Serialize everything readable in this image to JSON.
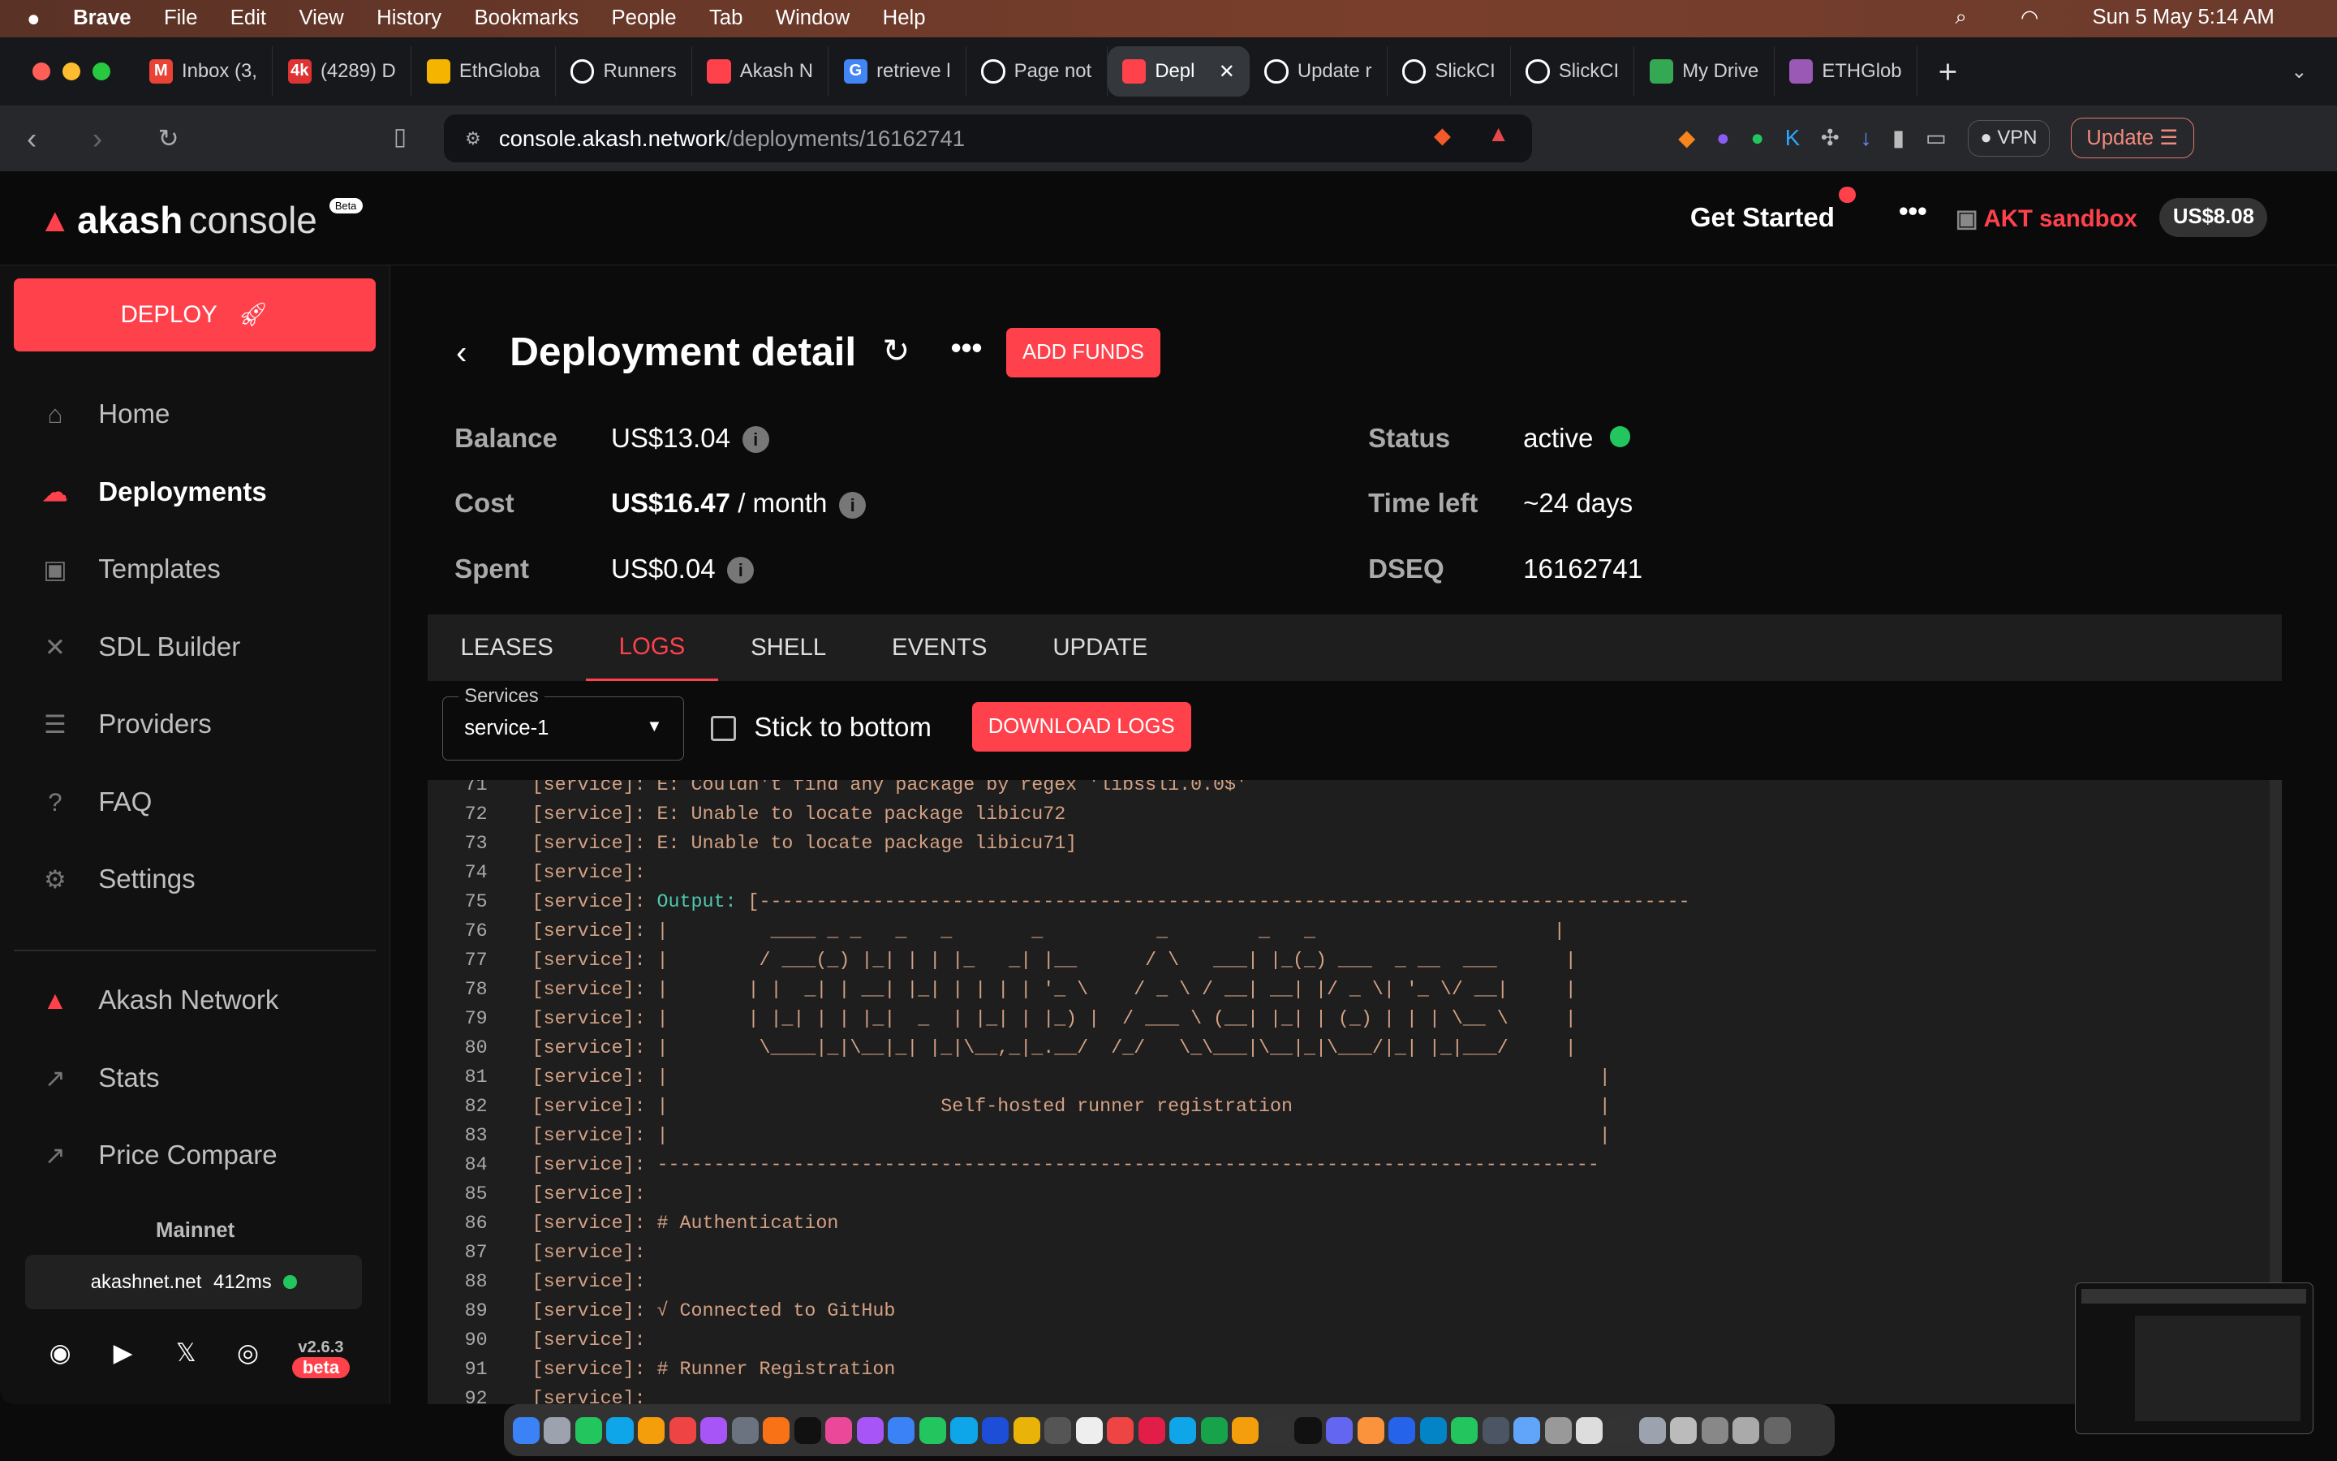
{
  "menubar": {
    "apple": "",
    "items": [
      "Brave",
      "File",
      "Edit",
      "View",
      "History",
      "Bookmarks",
      "People",
      "Tab",
      "Window",
      "Help"
    ],
    "datetime": "Sun 5 May  5:14 AM"
  },
  "browser": {
    "tabs": [
      {
        "label": "Inbox (3,",
        "icon": "gmail-icon",
        "color": "#ea4335",
        "glyph": "M"
      },
      {
        "label": "(4289) D",
        "icon": "4k-icon",
        "color": "#d33",
        "glyph": "4k"
      },
      {
        "label": "EthGloba",
        "icon": "slides-icon",
        "color": "#f4b400",
        "glyph": ""
      },
      {
        "label": "Runners",
        "icon": "github-icon",
        "color": "#fff",
        "glyph": ""
      },
      {
        "label": "Akash N",
        "icon": "akash-icon",
        "color": "#ff414c",
        "glyph": ""
      },
      {
        "label": "retrieve l",
        "icon": "google-icon",
        "color": "#4285f4",
        "glyph": "G"
      },
      {
        "label": "Page not",
        "icon": "github-icon",
        "color": "#fff",
        "glyph": ""
      },
      {
        "label": "Depl",
        "icon": "akash-icon",
        "color": "#ff414c",
        "glyph": "",
        "active": true
      },
      {
        "label": "Update r",
        "icon": "github-icon",
        "color": "#fff",
        "glyph": ""
      },
      {
        "label": "SlickCI",
        "icon": "slickci-icon",
        "color": "#fff",
        "glyph": ""
      },
      {
        "label": "SlickCI",
        "icon": "slickci-icon",
        "color": "#fff",
        "glyph": ""
      },
      {
        "label": "My Drive",
        "icon": "drive-icon",
        "color": "#34a853",
        "glyph": ""
      },
      {
        "label": "ETHGlob",
        "icon": "ethglobal-icon",
        "color": "#9b59b6",
        "glyph": ""
      }
    ],
    "url_host": "console.akash.network",
    "url_path": "/deployments/16162741",
    "vpn_label": "VPN",
    "update_label": "Update"
  },
  "header": {
    "logo_bold": "akash",
    "logo_light": "console",
    "beta": "Beta",
    "get_started": "Get Started",
    "wallet_name": "AKT sandbox",
    "wallet_balance": "US$8.08"
  },
  "sidebar": {
    "deploy_label": "DEPLOY",
    "items": [
      {
        "label": "Home",
        "icon": "home-icon",
        "glyph": "⌂"
      },
      {
        "label": "Deployments",
        "icon": "cloud-icon",
        "glyph": "☁",
        "active": true
      },
      {
        "label": "Templates",
        "icon": "image-icon",
        "glyph": "▣"
      },
      {
        "label": "SDL Builder",
        "icon": "tools-icon",
        "glyph": "✕"
      },
      {
        "label": "Providers",
        "icon": "server-icon",
        "glyph": "☰"
      },
      {
        "label": "FAQ",
        "icon": "help-icon",
        "glyph": "?"
      },
      {
        "label": "Settings",
        "icon": "gear-icon",
        "glyph": "⚙"
      }
    ],
    "links": [
      {
        "label": "Akash Network",
        "icon": "akash-icon",
        "glyph": "▲"
      },
      {
        "label": "Stats",
        "icon": "external-link-icon",
        "glyph": "↗"
      },
      {
        "label": "Price Compare",
        "icon": "external-link-icon",
        "glyph": "↗"
      }
    ],
    "network": "Mainnet",
    "node": "akashnet.net",
    "latency": "412ms",
    "version": "v2.6.3",
    "version_badge": "beta"
  },
  "deployment": {
    "title": "Deployment detail",
    "add_funds": "ADD FUNDS",
    "balance_label": "Balance",
    "balance": "US$13.04",
    "cost_label": "Cost",
    "cost": "US$16.47",
    "cost_unit": " / month",
    "spent_label": "Spent",
    "spent": "US$0.04",
    "status_label": "Status",
    "status": "active",
    "time_left_label": "Time left",
    "time_left": "~24 days",
    "dseq_label": "DSEQ",
    "dseq": "16162741",
    "tabs": [
      "LEASES",
      "LOGS",
      "SHELL",
      "EVENTS",
      "UPDATE"
    ],
    "active_tab": "LOGS",
    "services_label": "Services",
    "service_value": "service-1",
    "stick_to_bottom": "Stick to bottom",
    "stick_checked": false,
    "download_logs": "DOWNLOAD LOGS"
  },
  "logs": {
    "prefix": "[service]: ",
    "lines": [
      {
        "n": "71",
        "text": "E: Couldn't find any package by regex 'libssl1.0.0$'"
      },
      {
        "n": "72",
        "text": "E: Unable to locate package libicu72"
      },
      {
        "n": "73",
        "text": "E: Unable to locate package libicu71]"
      },
      {
        "n": "74",
        "text": ""
      },
      {
        "n": "75",
        "hl": "Output:",
        "text": " [----------------------------------------------------------------------------------"
      },
      {
        "n": "76",
        "text": "|         ____ _ _   _   _       _          _        _   _                     |"
      },
      {
        "n": "77",
        "text": "|        / ___(_) |_| | | |_   _| |__      / \\   ___| |_(_) ___  _ __  ___      |"
      },
      {
        "n": "78",
        "text": "|       | |  _| | __| |_| | | | | '_ \\    / _ \\ / __| __| |/ _ \\| '_ \\/ __|     |"
      },
      {
        "n": "79",
        "text": "|       | |_| | | |_|  _  | |_| | |_) |  / ___ \\ (__| |_| | (_) | | | \\__ \\     |"
      },
      {
        "n": "80",
        "text": "|        \\____|_|\\__|_| |_|\\__,_|_.__/  /_/   \\_\\___|\\__|_|\\___/|_| |_|___/     |"
      },
      {
        "n": "81",
        "text": "|                                                                                  |"
      },
      {
        "n": "82",
        "text": "|                        Self-hosted runner registration                           |"
      },
      {
        "n": "83",
        "text": "|                                                                                  |"
      },
      {
        "n": "84",
        "text": "-----------------------------------------------------------------------------------"
      },
      {
        "n": "85",
        "text": ""
      },
      {
        "n": "86",
        "text": "# Authentication"
      },
      {
        "n": "87",
        "text": ""
      },
      {
        "n": "88",
        "text": ""
      },
      {
        "n": "89",
        "text": "√ Connected to GitHub"
      },
      {
        "n": "90",
        "text": ""
      },
      {
        "n": "91",
        "text": "# Runner Registration"
      },
      {
        "n": "92",
        "text": ""
      }
    ]
  },
  "colors": {
    "accent": "#ff414c",
    "status_active": "#22c55e",
    "log_text": "#d4a184",
    "log_highlight": "#4ec9b0"
  }
}
